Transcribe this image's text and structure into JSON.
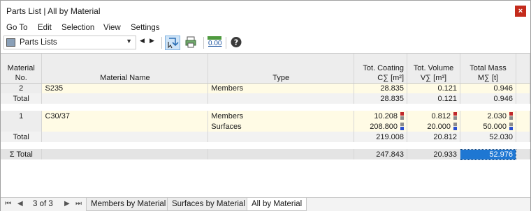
{
  "window": {
    "title": "Parts List | All by Material",
    "close_glyph": "×"
  },
  "menu": [
    "Go To",
    "Edit",
    "Selection",
    "View",
    "Settings"
  ],
  "toolbar": {
    "dropdown_value": "Parts Lists",
    "zero_label": "0.00"
  },
  "table": {
    "headers": {
      "material_no": [
        "Material",
        "No."
      ],
      "material_name": "Material Name",
      "type": "Type",
      "coating": [
        "Tot. Coating",
        "C∑ [m²]"
      ],
      "volume": [
        "Tot. Volume",
        "V∑ [m³]"
      ],
      "mass": [
        "Total Mass",
        "M∑ [t]"
      ]
    },
    "rows": [
      {
        "no": "2",
        "name": "S235",
        "type": "Members",
        "coating": "28.835",
        "volume": "0.121",
        "mass": "0.946"
      },
      {
        "no": "Total",
        "name": "",
        "type": "",
        "coating": "28.835",
        "volume": "0.121",
        "mass": "0.946"
      },
      {
        "no": "1",
        "name": "C30/37",
        "type": "Members",
        "coating": "10.208",
        "volume": "0.812",
        "mass": "2.030"
      },
      {
        "no": "",
        "name": "",
        "type": "Surfaces",
        "coating": "208.800",
        "volume": "20.000",
        "mass": "50.000"
      },
      {
        "no": "Total",
        "name": "",
        "type": "",
        "coating": "219.008",
        "volume": "20.812",
        "mass": "52.030"
      },
      {
        "no": "Σ Total",
        "name": "",
        "type": "",
        "coating": "247.843",
        "volume": "20.933",
        "mass": "52.976"
      }
    ]
  },
  "colors": {
    "marker_red": "#c0282a",
    "marker_blue": "#2a4fd0",
    "marker_gray": "#8c8c8c",
    "selection": "#1e77d3"
  },
  "status": {
    "page_count": "3 of 3",
    "tabs": [
      "Members by Material",
      "Surfaces by Material",
      "All by Material"
    ],
    "active_tab": "All by Material"
  }
}
